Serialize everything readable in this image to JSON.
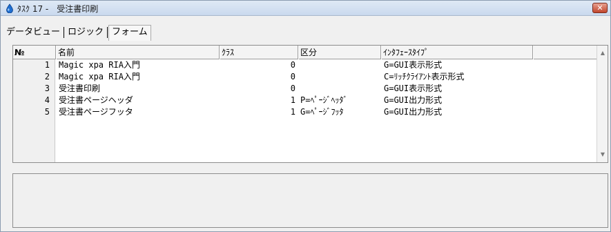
{
  "window": {
    "title": "ﾀｽｸ 17 -　受注書印刷",
    "close_glyph": "✕"
  },
  "tabs": [
    {
      "label": "データビュー",
      "active": false
    },
    {
      "label": "ロジック",
      "active": false
    },
    {
      "label": "フォーム",
      "active": true
    }
  ],
  "grid": {
    "columns": {
      "num": "№",
      "name": "名前",
      "class": "ｸﾗｽ",
      "kubun": "区分",
      "style": "ｲﾝﾀﾌｪｰｽﾀｲﾌﾟ"
    },
    "rows": [
      {
        "num": "1",
        "name": "Magic xpa RIA入門",
        "class": "0",
        "kubun": "",
        "style": "G=GUI表示形式"
      },
      {
        "num": "2",
        "name": "Magic xpa RIA入門",
        "class": "0",
        "kubun": "",
        "style": "C=ﾘｯﾁｸﾗｲｱﾝﾄ表示形式"
      },
      {
        "num": "3",
        "name": "受注書印刷",
        "class": "0",
        "kubun": "",
        "style": "G=GUI表示形式"
      },
      {
        "num": "4",
        "name": "受注書ページヘッダ",
        "class": "1",
        "kubun": "P=ﾍﾟｰｼﾞﾍｯﾀﾞ",
        "style": "G=GUI出力形式"
      },
      {
        "num": "5",
        "name": "受注書ページフッタ",
        "class": "1",
        "kubun": "G=ﾍﾟｰｼﾞﾌｯﾀ",
        "style": "G=GUI出力形式"
      }
    ]
  },
  "colors": {
    "title_gradient_top": "#dfe9f5",
    "close_button": "#c0452c",
    "window_bg": "#f0f0f0"
  }
}
